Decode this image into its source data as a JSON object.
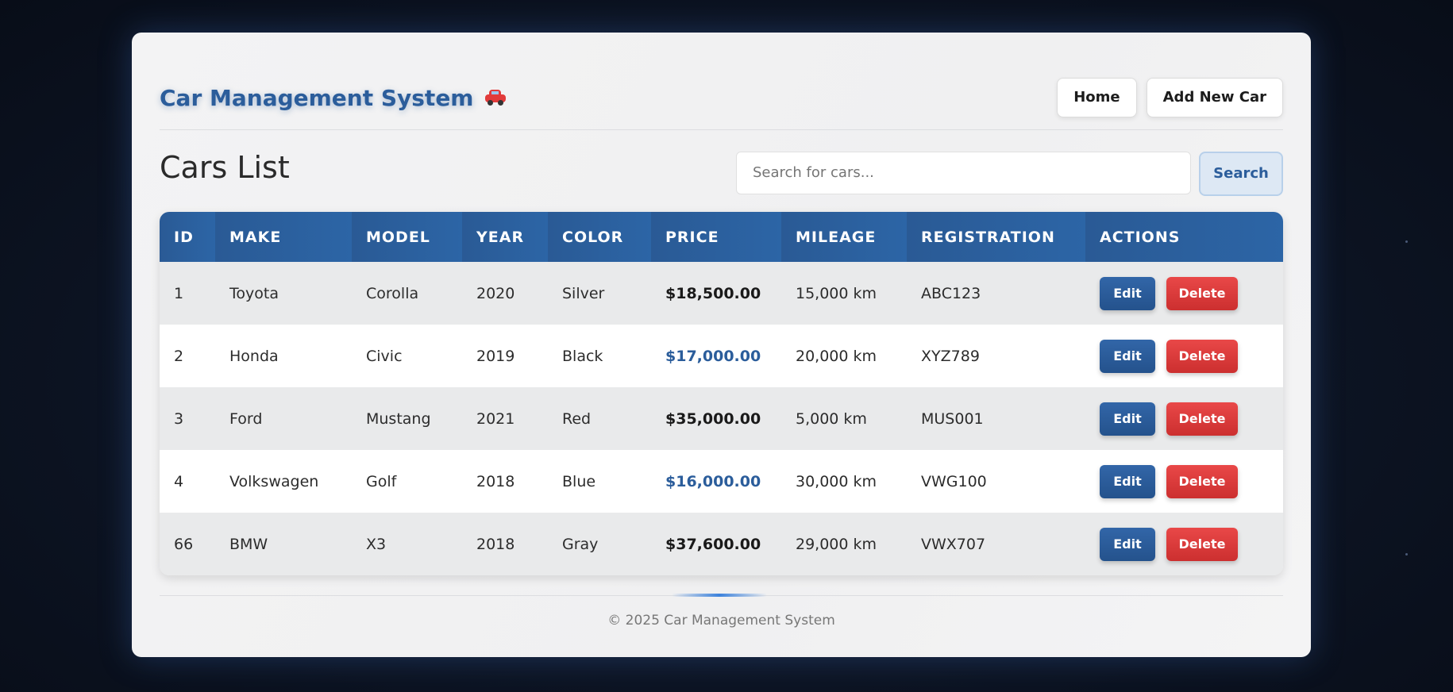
{
  "header": {
    "title": "Car Management System",
    "nav": [
      {
        "label": "Home"
      },
      {
        "label": "Add New Car"
      }
    ]
  },
  "main": {
    "page_title": "Cars List",
    "search": {
      "placeholder": "Search for cars...",
      "button_label": "Search"
    },
    "table": {
      "columns": [
        "ID",
        "MAKE",
        "MODEL",
        "YEAR",
        "COLOR",
        "PRICE",
        "MILEAGE",
        "REGISTRATION",
        "ACTIONS"
      ],
      "rows": [
        {
          "id": "1",
          "make": "Toyota",
          "model": "Corolla",
          "year": "2020",
          "color": "Silver",
          "price": "$18,500.00",
          "mileage": "15,000 km",
          "registration": "ABC123"
        },
        {
          "id": "2",
          "make": "Honda",
          "model": "Civic",
          "year": "2019",
          "color": "Black",
          "price": "$17,000.00",
          "mileage": "20,000 km",
          "registration": "XYZ789"
        },
        {
          "id": "3",
          "make": "Ford",
          "model": "Mustang",
          "year": "2021",
          "color": "Red",
          "price": "$35,000.00",
          "mileage": "5,000 km",
          "registration": "MUS001"
        },
        {
          "id": "4",
          "make": "Volkswagen",
          "model": "Golf",
          "year": "2018",
          "color": "Blue",
          "price": "$16,000.00",
          "mileage": "30,000 km",
          "registration": "VWG100"
        },
        {
          "id": "66",
          "make": "BMW",
          "model": "X3",
          "year": "2018",
          "color": "Gray",
          "price": "$37,600.00",
          "mileage": "29,000 km",
          "registration": "VWX707"
        }
      ],
      "edit_label": "Edit",
      "delete_label": "Delete"
    }
  },
  "footer": {
    "text": "© 2025 Car Management System"
  },
  "colors": {
    "brand": "#2b5d9b",
    "header_bg": "#2a5a95",
    "delete": "#e23b3b",
    "edit": "#2c5e9e"
  },
  "icons": {
    "title_icon": "car-icon"
  }
}
